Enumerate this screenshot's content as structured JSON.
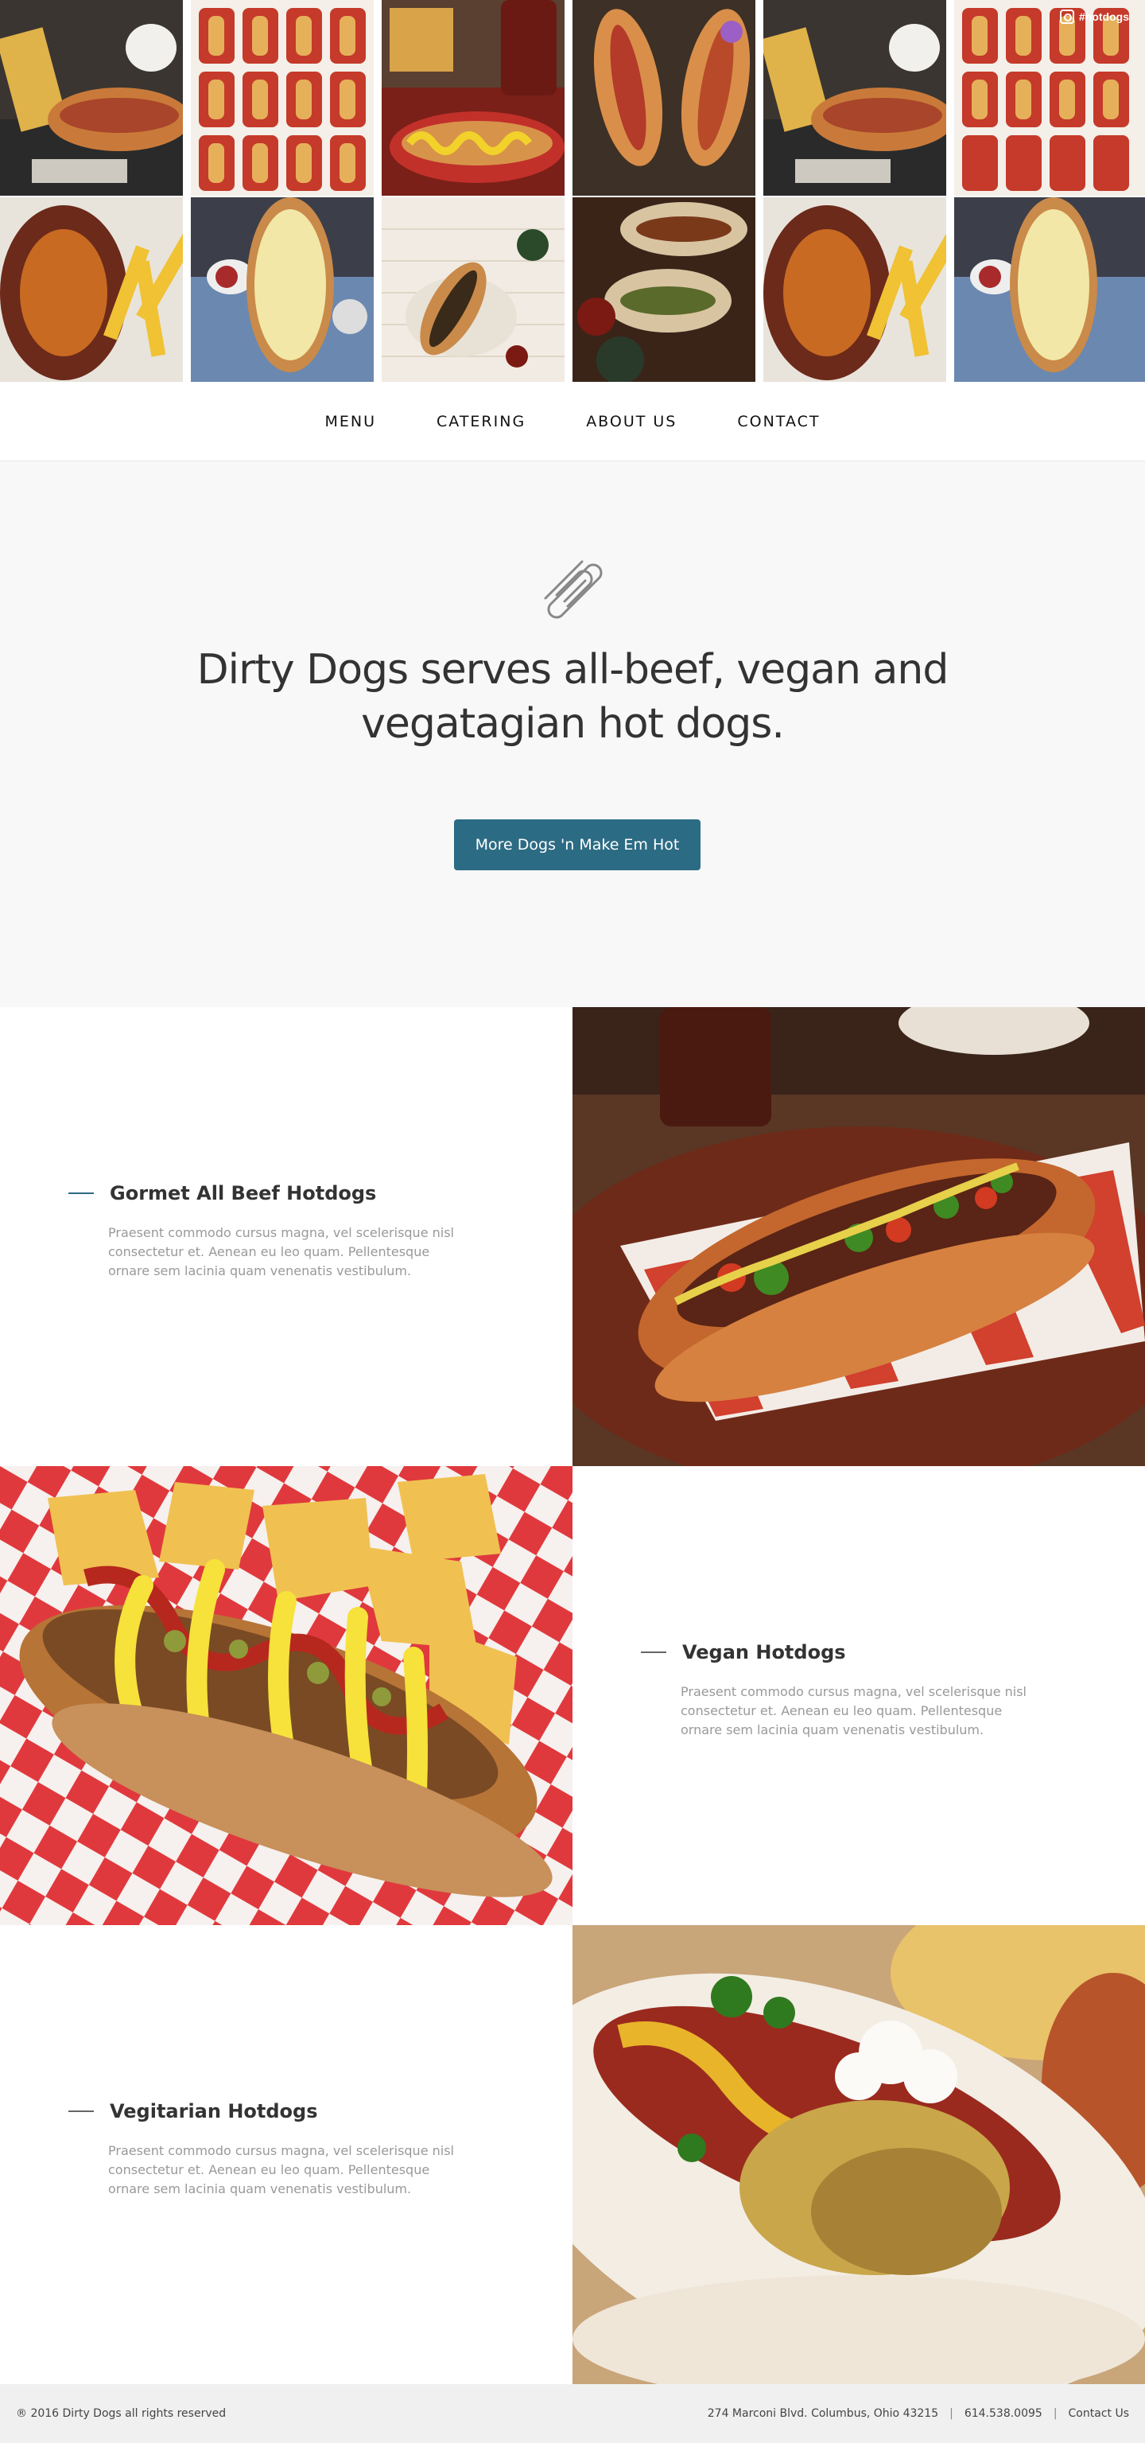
{
  "instagram": {
    "tag": "#hotdogs",
    "icon": "instagram-icon"
  },
  "nav": {
    "items": [
      "MENU",
      "CATERING",
      "ABOUT US",
      "CONTACT"
    ]
  },
  "hero": {
    "icon": "hotdog-icon",
    "headline_line1": "Dirty Dogs serves all-beef, vegan and",
    "headline_line2": "vegatagian hot dogs.",
    "cta_label": "More Dogs 'n Make Em Hot",
    "accent_color": "#2c6b84"
  },
  "features": [
    {
      "title": "Gormet All Beef Hotdogs",
      "body": "Praesent commodo cursus magna, vel scelerisque nisl consectetur et. Aenean eu leo quam. Pellentesque ornare sem lacinia quam venenatis vestibulum."
    },
    {
      "title": "Vegan Hotdogs",
      "body": "Praesent commodo cursus magna, vel scelerisque nisl consectetur et. Aenean eu leo quam. Pellentesque ornare sem lacinia quam venenatis vestibulum."
    },
    {
      "title": "Vegitarian Hotdogs",
      "body": "Praesent commodo cursus magna, vel scelerisque nisl consectetur et. Aenean eu leo quam. Pellentesque ornare sem lacinia quam venenatis vestibulum."
    }
  ],
  "footer": {
    "copyright": "® 2016 Dirty Dogs all rights reserved",
    "address": "274 Marconi Blvd. Columbus, Ohio 43215",
    "phone": "614.538.0095",
    "contact_link": "Contact Us",
    "separator": "|"
  }
}
